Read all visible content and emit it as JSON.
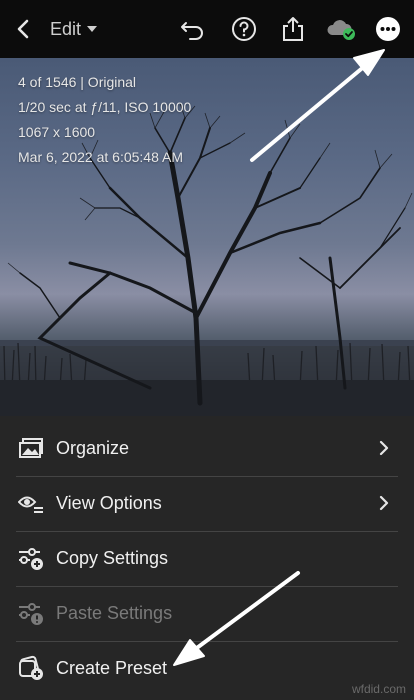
{
  "toolbar": {
    "edit_label": "Edit",
    "icons": [
      "back-icon",
      "chevron-down-icon",
      "undo-icon",
      "help-icon",
      "share-icon",
      "cloud-synced-icon",
      "more-icon"
    ]
  },
  "photo_info": {
    "line1": "4 of 1546 | Original",
    "line2": "1/20 sec at ƒ/11, ISO 10000",
    "line3": "1067 x 1600",
    "line4": "Mar 6, 2022 at 6:05:48 AM"
  },
  "menu": {
    "items": [
      {
        "label": "Organize",
        "icon": "organize-icon",
        "has_submenu": true,
        "enabled": true
      },
      {
        "label": "View Options",
        "icon": "view-options-icon",
        "has_submenu": true,
        "enabled": true
      },
      {
        "label": "Copy Settings",
        "icon": "copy-settings-icon",
        "has_submenu": false,
        "enabled": true
      },
      {
        "label": "Paste Settings",
        "icon": "paste-settings-icon",
        "has_submenu": false,
        "enabled": false
      },
      {
        "label": "Create Preset",
        "icon": "create-preset-icon",
        "has_submenu": false,
        "enabled": true
      }
    ]
  },
  "watermark": "wfdid.com",
  "colors": {
    "toolbar_bg": "#0c0c0c",
    "menu_bg": "#262626",
    "sync_green": "#3dbb5a",
    "disabled_text": "#7a7a7a",
    "annotation_arrow": "#ffffff"
  }
}
